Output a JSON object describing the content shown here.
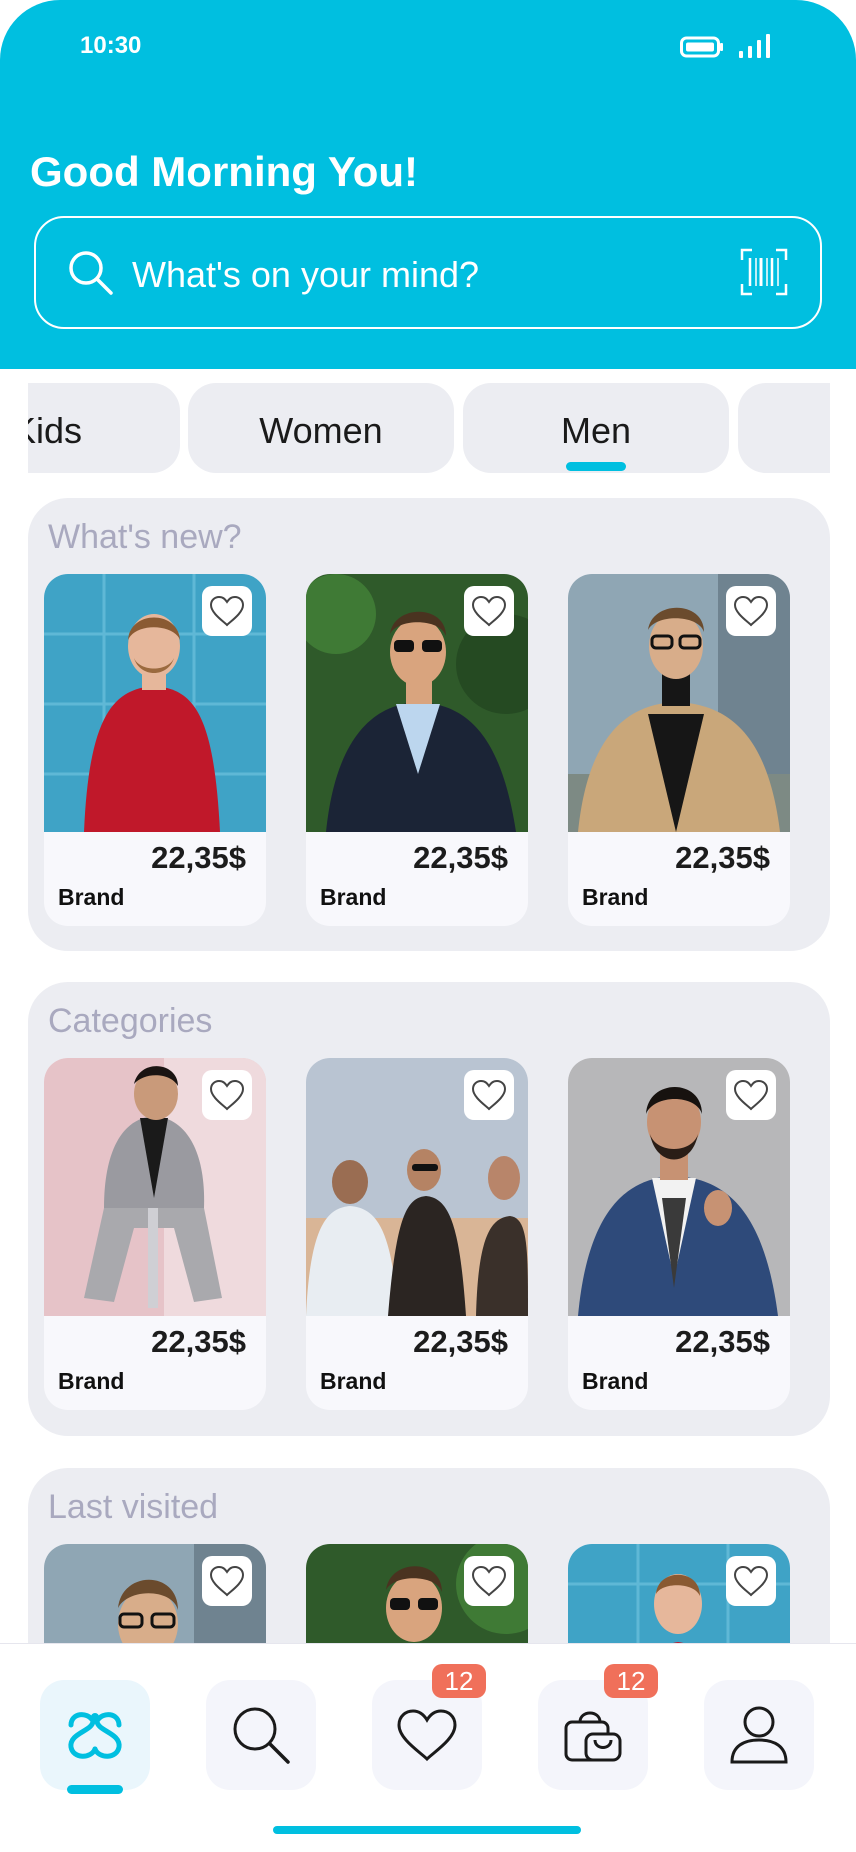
{
  "status_bar": {
    "time": "10:30"
  },
  "header": {
    "greeting": "Good Morning You!",
    "search_placeholder": "What's on your mind?"
  },
  "tabs": [
    {
      "label": "Kids",
      "active": false
    },
    {
      "label": "Women",
      "active": false
    },
    {
      "label": "Men",
      "active": true
    },
    {
      "label": "",
      "active": false
    }
  ],
  "sections": [
    {
      "title": "What's new?",
      "items": [
        {
          "price": "22,35$",
          "brand": "Brand"
        },
        {
          "price": "22,35$",
          "brand": "Brand"
        },
        {
          "price": "22,35$",
          "brand": "Brand"
        }
      ]
    },
    {
      "title": "Categories",
      "items": [
        {
          "price": "22,35$",
          "brand": "Brand"
        },
        {
          "price": "22,35$",
          "brand": "Brand"
        },
        {
          "price": "22,35$",
          "brand": "Brand"
        }
      ]
    },
    {
      "title": "Last visited",
      "items": [
        {},
        {},
        {}
      ]
    }
  ],
  "bottom_nav": {
    "items": [
      {
        "icon": "home-logo-icon",
        "active": true
      },
      {
        "icon": "search-icon",
        "active": false
      },
      {
        "icon": "heart-icon",
        "active": false,
        "badge": "12"
      },
      {
        "icon": "shopping-bag-icon",
        "active": false,
        "badge": "12"
      },
      {
        "icon": "profile-icon",
        "active": false
      }
    ]
  },
  "colors": {
    "accent": "#00bfe0",
    "badge": "#f0705a",
    "section_bg": "#ecedf2",
    "section_title": "#a9a9bf"
  }
}
